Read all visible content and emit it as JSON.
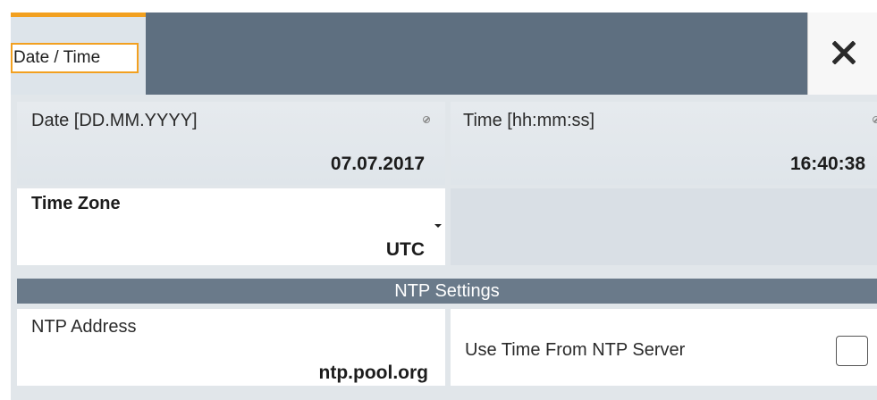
{
  "window": {
    "tab_label": "Date / Time",
    "accent_color": "#f2a020",
    "header_color": "#5e6f80",
    "close_icon": "close-icon"
  },
  "date": {
    "label": "Date [DD.MM.YYYY]",
    "value": "07.07.2017"
  },
  "time": {
    "label": "Time [hh:mm:ss]",
    "value": "16:40:38"
  },
  "timezone": {
    "label": "Time Zone",
    "value": "UTC"
  },
  "ntp": {
    "section_title": "NTP Settings",
    "address_label": "NTP Address",
    "address_value": "ntp.pool.org",
    "use_ntp_label": "Use Time From NTP Server",
    "use_ntp_checked": false
  }
}
